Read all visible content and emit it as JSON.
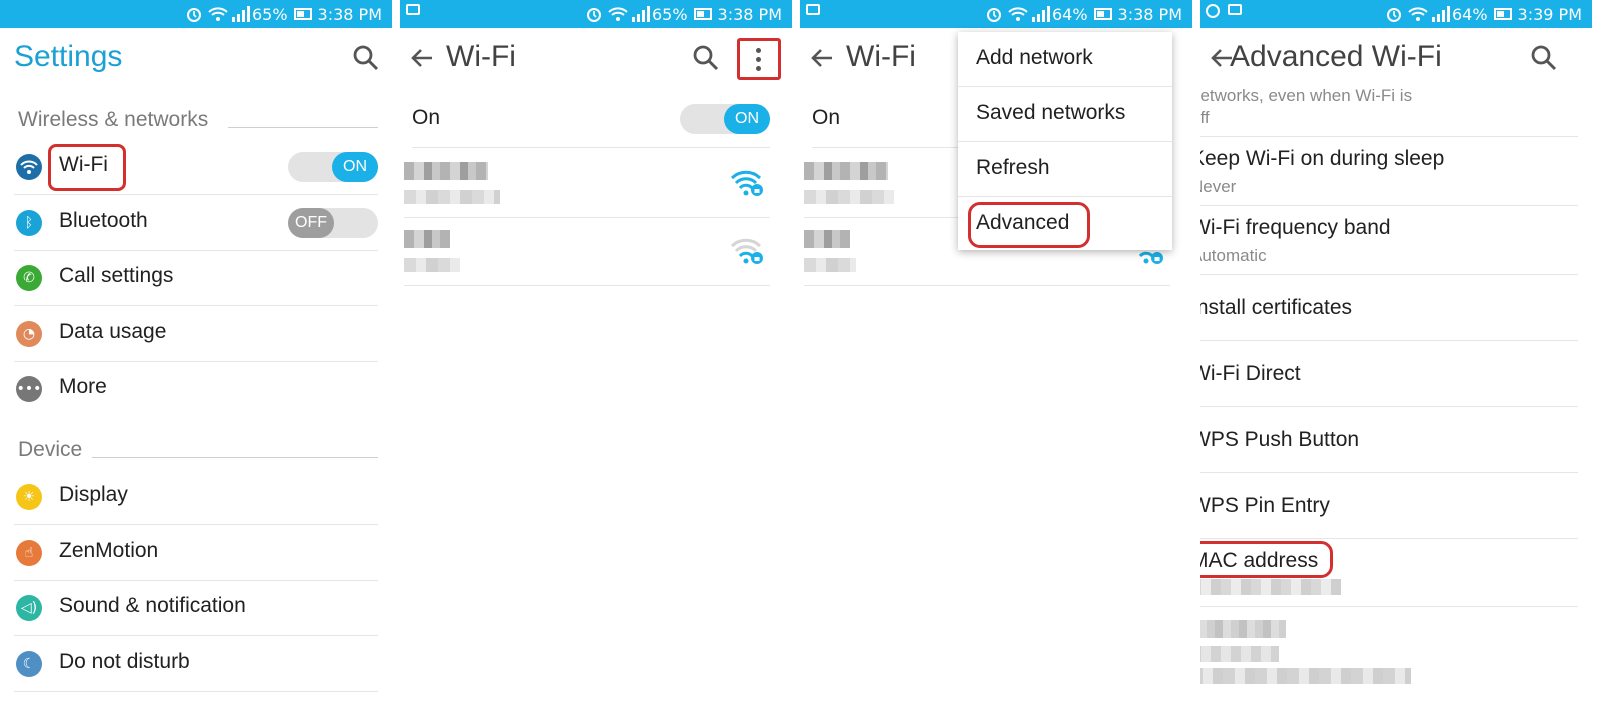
{
  "colors": {
    "accent": "#1ab0e8",
    "title_blue": "#1ba1d4",
    "highlight": "#d32f2f"
  },
  "panels": [
    {
      "status": {
        "percent": "65%",
        "time": "3:38 PM"
      },
      "title": "Settings",
      "sections": [
        {
          "label": "Wireless & networks",
          "items": [
            {
              "label": "Wi-Fi",
              "icon": "wifi-icon",
              "toggle": "ON"
            },
            {
              "label": "Bluetooth",
              "icon": "bluetooth-icon",
              "toggle": "OFF"
            },
            {
              "label": "Call settings",
              "icon": "phone-icon"
            },
            {
              "label": "Data usage",
              "icon": "data-usage-icon"
            },
            {
              "label": "More",
              "icon": "more-icon"
            }
          ]
        },
        {
          "label": "Device",
          "items": [
            {
              "label": "Display",
              "icon": "display-icon"
            },
            {
              "label": "ZenMotion",
              "icon": "zenmotion-icon"
            },
            {
              "label": "Sound & notification",
              "icon": "sound-icon"
            },
            {
              "label": "Do not disturb",
              "icon": "moon-icon"
            }
          ]
        }
      ]
    },
    {
      "status": {
        "percent": "65%",
        "time": "3:38 PM"
      },
      "title": "Wi-Fi",
      "on_label": "On",
      "toggle": "ON"
    },
    {
      "status": {
        "percent": "64%",
        "time": "3:38 PM"
      },
      "title": "Wi-Fi",
      "on_label": "On",
      "menu": [
        "Add network",
        "Saved networks",
        "Refresh",
        "Advanced"
      ]
    },
    {
      "status": {
        "percent": "64%",
        "time": "3:39 PM"
      },
      "title": "Advanced Wi-Fi",
      "partial_text": "networks, even when Wi-Fi is",
      "partial_text2": "off",
      "items": [
        {
          "title": "Keep Wi-Fi on during sleep",
          "subtitle": "Never"
        },
        {
          "title": "Wi-Fi frequency band",
          "subtitle": "Automatic"
        },
        {
          "title": "Install certificates"
        },
        {
          "title": "Wi-Fi Direct"
        },
        {
          "title": "WPS Push Button"
        },
        {
          "title": "WPS Pin Entry"
        },
        {
          "title": "MAC address"
        }
      ]
    }
  ]
}
